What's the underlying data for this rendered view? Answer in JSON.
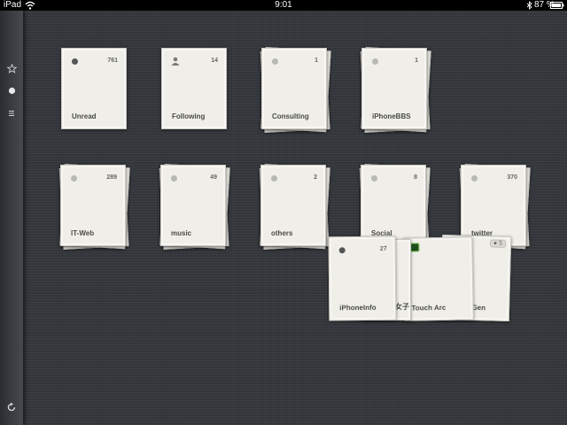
{
  "statusbar": {
    "carrier": "iPad",
    "time": "9:01",
    "battery": "87 %"
  },
  "sidebar": {
    "icons": [
      "star-icon",
      "dot-icon",
      "list-icon"
    ],
    "refresh": "refresh-icon"
  },
  "cards": [
    {
      "title": "Unread",
      "count": "761",
      "marker": "dark-dot"
    },
    {
      "title": "Following",
      "count": "14",
      "marker": "person-icon"
    },
    {
      "title": "Consulting",
      "count": "1",
      "marker": "dot"
    },
    {
      "title": "iPhoneBBS",
      "count": "1",
      "marker": "dot"
    },
    {
      "title": "IT-Web",
      "count": "289",
      "marker": "dot"
    },
    {
      "title": "music",
      "count": "49",
      "marker": "dot"
    },
    {
      "title": "others",
      "count": "2",
      "marker": "dot"
    },
    {
      "title": "Social",
      "count": "8",
      "marker": "dot"
    },
    {
      "title": "twitter",
      "count": "370",
      "marker": "dot"
    }
  ],
  "fan": [
    {
      "title": "iPhoneInfo",
      "count": "27"
    },
    {
      "title": "女子"
    },
    {
      "title": "Touch Arc"
    },
    {
      "title": "TouchGen",
      "badge": "5"
    }
  ],
  "colors": {
    "background": "#34373c",
    "card": "#efeee9",
    "text": "#4a4a48"
  }
}
